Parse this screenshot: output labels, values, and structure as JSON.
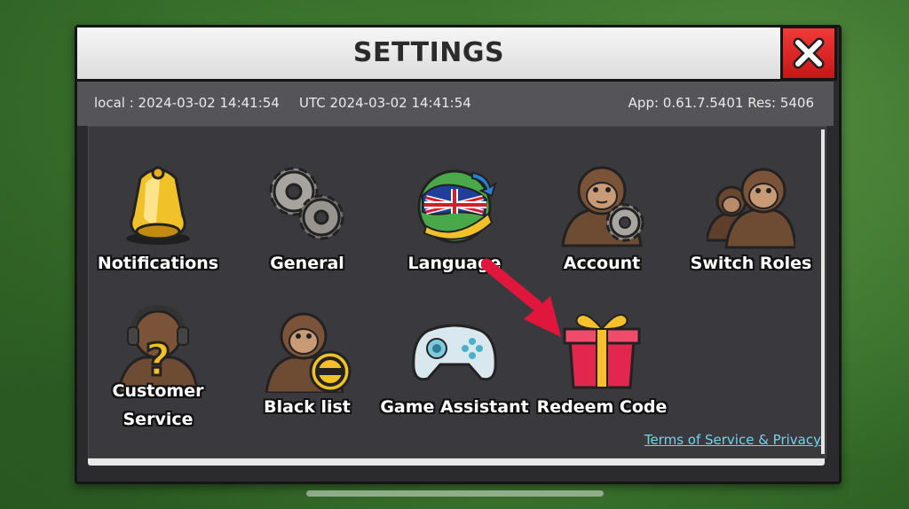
{
  "header": {
    "title": "SETTINGS",
    "close_icon": "close-x-icon"
  },
  "info": {
    "local": "local : 2024-03-02 14:41:54",
    "utc": "UTC 2024-03-02 14:41:54",
    "version": "App: 0.61.7.5401 Res: 5406"
  },
  "items": [
    {
      "label": "Notifications",
      "icon": "bell-icon"
    },
    {
      "label": "General",
      "icon": "gears-icon"
    },
    {
      "label": "Language",
      "icon": "globe-flag-icon"
    },
    {
      "label": "Account",
      "icon": "monkey-gear-icon"
    },
    {
      "label": "Switch Roles",
      "icon": "monkeys-icon"
    },
    {
      "label_line1": "Customer",
      "label_line2": "Service",
      "icon": "monkey-headset-question-icon"
    },
    {
      "label": "Black list",
      "icon": "monkey-block-icon"
    },
    {
      "label": "Game Assistant",
      "icon": "gamepad-icon"
    },
    {
      "label": "Redeem Code",
      "icon": "gift-box-icon"
    }
  ],
  "footer": {
    "terms_link": "Terms of Service & Privacy"
  },
  "colors": {
    "accent_red": "#e0163c",
    "link": "#6fd6e8",
    "panel": "#3a3a3e"
  }
}
